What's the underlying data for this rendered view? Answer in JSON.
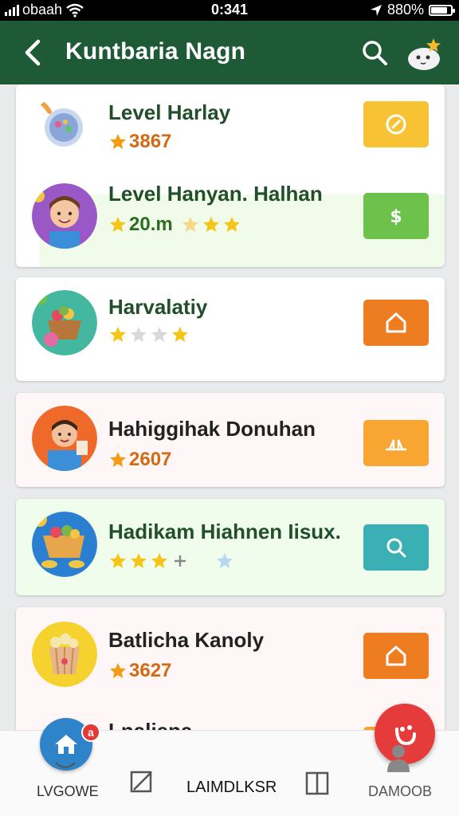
{
  "status": {
    "carrier": "obaah",
    "time": "0:341",
    "battery": "880%"
  },
  "header": {
    "title": "Kuntbaria Nagn"
  },
  "rows": [
    {
      "title": "Level Harlay",
      "meta": "3867",
      "action_color": "#f7c233"
    },
    {
      "title": "Level Hanyan. Halhan",
      "meta": "20.m",
      "action_color": "#6cc24a"
    },
    {
      "title": "Harvalatiy",
      "meta": "",
      "action_color": "#ed7d20"
    },
    {
      "title": "Hahiggihak Donuhan",
      "meta": "2607",
      "action_color": "#f9a531"
    },
    {
      "title": "Hadikam Hiahnen Iisux.",
      "meta": "",
      "action_color": "#3ab0b5"
    },
    {
      "title": "Batlicha Kanoly",
      "meta": "3627",
      "action_color": "#ed7d20"
    },
    {
      "title": "Lnaliena",
      "meta": "",
      "action_color": "#f7a531"
    }
  ],
  "nav": {
    "home_badge": "a",
    "items": [
      {
        "label": "LVGOWE"
      },
      {
        "label": "LAIMDLKSR"
      },
      {
        "label": "DAMOOB"
      }
    ]
  }
}
